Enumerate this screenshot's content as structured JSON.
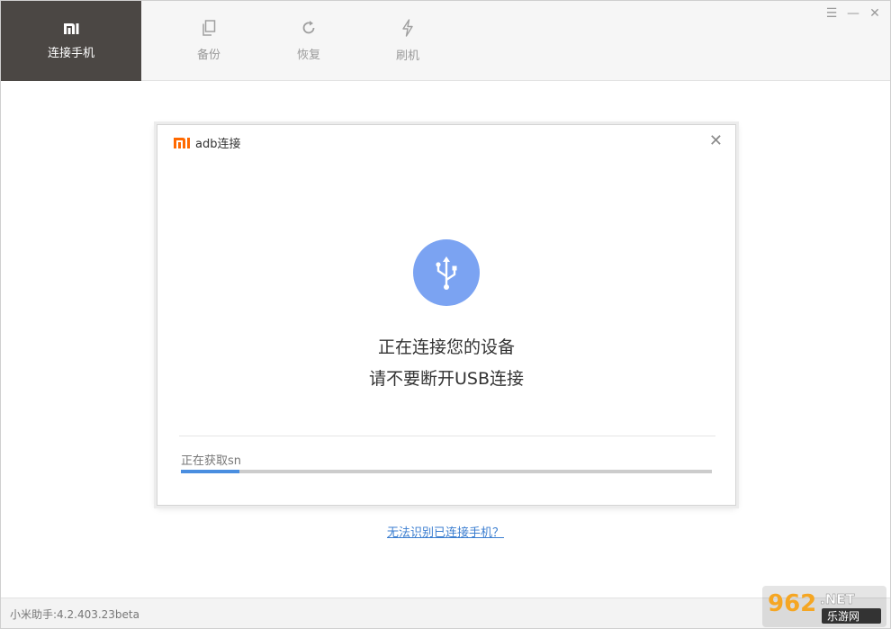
{
  "tabs": [
    {
      "label": "连接手机",
      "icon": "mi-logo",
      "active": true
    },
    {
      "label": "备份",
      "icon": "copy-icon",
      "active": false
    },
    {
      "label": "恢复",
      "icon": "refresh-icon",
      "active": false
    },
    {
      "label": "刷机",
      "icon": "lightning-icon",
      "active": false
    }
  ],
  "window_controls": {
    "menu": "☰",
    "minimize": "—",
    "close": "✕"
  },
  "dialog": {
    "title": "adb连接",
    "close": "✕",
    "icon": "usb-icon",
    "message_line1": "正在连接您的设备",
    "message_line2": "请不要断开USB连接",
    "progress_label": "正在获取sn",
    "progress_fraction": 0.11
  },
  "help_link": "无法识别已连接手机？",
  "version": "小米助手:4.2.403.23beta",
  "colors": {
    "active_tab_bg": "#4b4744",
    "brand_orange": "#ff6900",
    "usb_circle": "#7ba3f2",
    "progress_fill": "#4a8ee0",
    "link": "#3b7ed0"
  },
  "watermark": {
    "text_top": "962.NET",
    "text_bottom": "乐游网"
  }
}
